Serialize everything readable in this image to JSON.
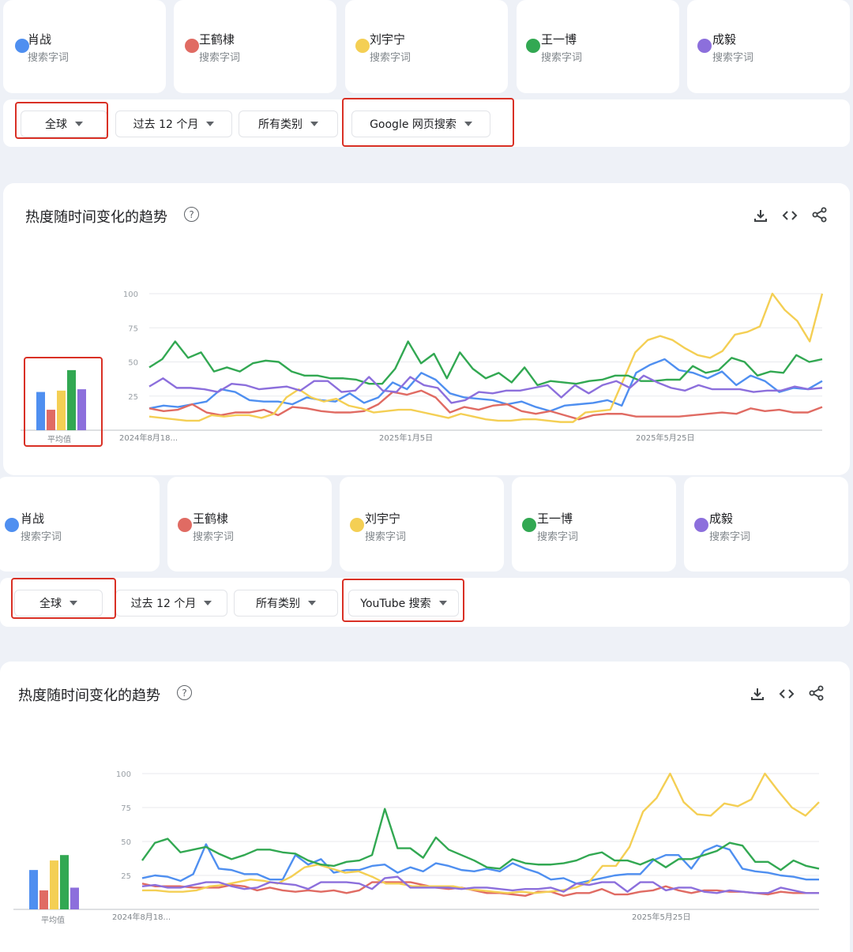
{
  "terms": [
    {
      "name": "肖战",
      "sub": "搜索字词",
      "color": "#4f8ff0"
    },
    {
      "name": "王鹤棣",
      "sub": "搜索字词",
      "color": "#e06b63"
    },
    {
      "name": "刘宇宁",
      "sub": "搜索字词",
      "color": "#f4cf54"
    },
    {
      "name": "王一博",
      "sub": "搜索字词",
      "color": "#32a852"
    },
    {
      "name": "成毅",
      "sub": "搜索字词",
      "color": "#8c6fdc"
    }
  ],
  "panel1": {
    "filters": {
      "region": "全球",
      "time": "过去 12 个月",
      "category": "所有类别",
      "source": "Google 网页搜索"
    },
    "title": "热度随时间变化的趋势",
    "help": "?",
    "avg_label": "平均值"
  },
  "panel2": {
    "filters": {
      "region": "全球",
      "time": "过去 12 个月",
      "category": "所有类别",
      "source": "YouTube 搜索"
    },
    "title": "热度随时间变化的趋势",
    "help": "?",
    "avg_label": "平均值"
  },
  "chart_data": [
    {
      "type": "line",
      "title": "热度随时间变化的趋势",
      "ylim": [
        0,
        100
      ],
      "yticks": [
        "100",
        "75",
        "50",
        "25"
      ],
      "x_labels": [
        "2024年8月18...",
        "2025年1月5日",
        "2025年5月25日"
      ],
      "averages": [
        28,
        15,
        29,
        44,
        30
      ],
      "series": [
        {
          "name": "肖战",
          "color": "#4f8ff0",
          "values": [
            16,
            18,
            17,
            19,
            21,
            30,
            28,
            22,
            21,
            21,
            19,
            24,
            22,
            21,
            27,
            20,
            24,
            35,
            30,
            42,
            37,
            27,
            24,
            23,
            22,
            19,
            21,
            17,
            14,
            18,
            19,
            20,
            22,
            18,
            42,
            48,
            52,
            44,
            42,
            38,
            43,
            33,
            40,
            36,
            28,
            31,
            30,
            36
          ]
        },
        {
          "name": "王鹤棣",
          "color": "#e06b63",
          "values": [
            16,
            14,
            15,
            19,
            13,
            11,
            13,
            13,
            15,
            11,
            17,
            16,
            14,
            13,
            13,
            14,
            19,
            28,
            26,
            29,
            24,
            13,
            17,
            15,
            18,
            19,
            14,
            12,
            14,
            11,
            8,
            11,
            12,
            12,
            10,
            10,
            10,
            10,
            11,
            12,
            13,
            12,
            16,
            14,
            15,
            13,
            13,
            17
          ]
        },
        {
          "name": "刘宇宁",
          "color": "#f4cf54",
          "values": [
            10,
            9,
            8,
            7,
            7,
            11,
            10,
            11,
            11,
            9,
            12,
            24,
            30,
            24,
            21,
            23,
            18,
            16,
            13,
            14,
            15,
            15,
            13,
            11,
            9,
            12,
            10,
            8,
            7,
            7,
            8,
            8,
            7,
            6,
            6,
            13,
            14,
            15,
            36,
            57,
            66,
            69,
            66,
            60,
            55,
            53,
            58,
            70,
            72,
            76,
            100,
            88,
            80,
            65,
            100
          ]
        },
        {
          "name": "王一博",
          "color": "#32a852",
          "values": [
            46,
            52,
            65,
            53,
            57,
            43,
            46,
            43,
            49,
            51,
            50,
            43,
            40,
            40,
            38,
            38,
            37,
            34,
            34,
            45,
            65,
            49,
            56,
            38,
            57,
            45,
            38,
            42,
            35,
            46,
            33,
            36,
            35,
            34,
            36,
            37,
            40,
            40,
            36,
            36,
            37,
            37,
            47,
            42,
            44,
            53,
            50,
            40,
            43,
            42,
            55,
            50,
            52
          ]
        },
        {
          "name": "成毅",
          "color": "#8c6fdc",
          "values": [
            32,
            38,
            31,
            31,
            30,
            28,
            34,
            33,
            30,
            31,
            32,
            29,
            36,
            36,
            28,
            29,
            39,
            29,
            28,
            39,
            33,
            31,
            20,
            22,
            28,
            27,
            29,
            29,
            31,
            33,
            24,
            33,
            27,
            33,
            36,
            31,
            40,
            35,
            31,
            29,
            33,
            30,
            30,
            30,
            28,
            29,
            29,
            32,
            30,
            31
          ]
        }
      ]
    },
    {
      "type": "line",
      "title": "热度随时间变化的趋势",
      "ylim": [
        0,
        100
      ],
      "yticks": [
        "100",
        "75",
        "50",
        "25"
      ],
      "x_labels": [
        "2024年8月18...",
        "2025年5月25日"
      ],
      "averages": [
        29,
        14,
        36,
        40,
        16
      ],
      "series": [
        {
          "name": "肖战",
          "color": "#4f8ff0",
          "values": [
            23,
            25,
            24,
            21,
            26,
            48,
            30,
            29,
            26,
            26,
            22,
            22,
            40,
            33,
            37,
            27,
            29,
            29,
            32,
            33,
            27,
            31,
            28,
            34,
            32,
            29,
            28,
            30,
            28,
            34,
            30,
            27,
            22,
            23,
            19,
            21,
            23,
            25,
            26,
            26,
            36,
            40,
            40,
            30,
            43,
            47,
            44,
            30,
            28,
            27,
            25,
            24,
            22,
            22
          ]
        },
        {
          "name": "王鹤棣",
          "color": "#e06b63",
          "values": [
            19,
            17,
            17,
            17,
            16,
            16,
            16,
            18,
            17,
            14,
            16,
            14,
            13,
            14,
            13,
            14,
            12,
            14,
            20,
            20,
            20,
            20,
            18,
            16,
            15,
            16,
            14,
            12,
            12,
            11,
            10,
            13,
            13,
            10,
            12,
            12,
            15,
            11,
            11,
            13,
            14,
            17,
            14,
            12,
            14,
            14,
            13,
            13,
            12,
            11,
            13,
            12,
            12,
            12
          ]
        },
        {
          "name": "刘宇宁",
          "color": "#f4cf54",
          "values": [
            14,
            14,
            13,
            13,
            14,
            17,
            18,
            20,
            22,
            21,
            19,
            24,
            31,
            33,
            30,
            27,
            28,
            24,
            19,
            19,
            17,
            17,
            17,
            17,
            15,
            14,
            13,
            12,
            13,
            12,
            13,
            14,
            16,
            20,
            32,
            32,
            46,
            72,
            82,
            100,
            79,
            70,
            69,
            78,
            76,
            81,
            100,
            87,
            75,
            69,
            79
          ]
        },
        {
          "name": "王一博",
          "color": "#32a852",
          "values": [
            36,
            49,
            52,
            42,
            44,
            46,
            41,
            37,
            40,
            44,
            44,
            42,
            41,
            36,
            33,
            32,
            35,
            36,
            40,
            74,
            45,
            45,
            38,
            53,
            44,
            40,
            36,
            31,
            30,
            37,
            34,
            33,
            33,
            34,
            36,
            40,
            42,
            36,
            36,
            33,
            37,
            31,
            37,
            37,
            40,
            43,
            49,
            47,
            35,
            35,
            29,
            36,
            32,
            30
          ]
        },
        {
          "name": "成毅",
          "color": "#8c6fdc",
          "values": [
            17,
            18,
            16,
            16,
            18,
            20,
            20,
            17,
            15,
            16,
            20,
            19,
            18,
            15,
            20,
            20,
            20,
            19,
            15,
            23,
            24,
            16,
            16,
            16,
            16,
            15,
            16,
            16,
            15,
            14,
            15,
            15,
            16,
            13,
            19,
            18,
            20,
            20,
            13,
            20,
            20,
            14,
            16,
            16,
            13,
            12,
            14,
            13,
            12,
            12,
            16,
            14,
            12,
            12
          ]
        }
      ]
    }
  ]
}
